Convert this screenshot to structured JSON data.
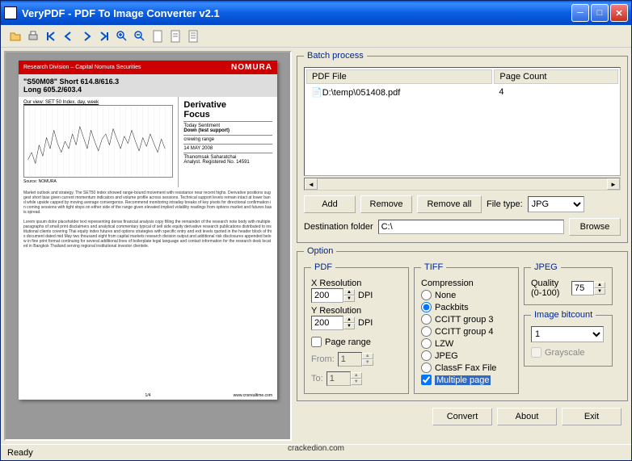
{
  "window": {
    "title": "VeryPDF - PDF To Image Converter v2.1"
  },
  "toolbar_icons": [
    "open-icon",
    "print-icon",
    "first-icon",
    "prev-icon",
    "next-icon",
    "last-icon",
    "zoomin-icon",
    "zoomout-icon",
    "page1-icon",
    "page2-icon",
    "page3-icon"
  ],
  "preview": {
    "header_left": "Research Division – Capital Nomura Securities",
    "header_brand": "NOMURA",
    "title_line1": "\"S50M08\" Short 614.8/616.3",
    "title_line2": "Long 605.2/603.4",
    "ourview": "Our view: SET 50 Index, day, week",
    "side_h1": "Derivative",
    "side_h2": "Focus",
    "side_sent_label": "Today Sentiment",
    "side_sent_val": "Down (test support)",
    "side_strategy": "crewing range",
    "side_date": "14 MAY 2008",
    "side_analyst1": "Thanomsak Saharatchai",
    "side_analyst2": "Analyst. Registered No. 14591",
    "footer_url": "www.cnsrealtime.com",
    "page_num": "1/4"
  },
  "batch": {
    "legend": "Batch process",
    "col_file": "PDF File",
    "col_count": "Page Count",
    "row_file": "D:\\temp\\051408.pdf",
    "row_count": "4",
    "add": "Add",
    "remove": "Remove",
    "removeall": "Remove all",
    "filetype_label": "File type:",
    "filetype_value": "JPG",
    "dest_label": "Destination folder",
    "dest_value": "C:\\",
    "browse": "Browse"
  },
  "option": {
    "legend": "Option",
    "pdf": {
      "legend": "PDF",
      "xres": "X Resolution",
      "yres": "Y Resolution",
      "xval": "200",
      "yval": "200",
      "dpi": "DPI",
      "pagerange": "Page range",
      "from": "From:",
      "to": "To:",
      "fromval": "1",
      "toval": "1"
    },
    "tiff": {
      "legend": "TIFF",
      "comp": "Compression",
      "none": "None",
      "packbits": "Packbits",
      "ccitt3": "CCITT group 3",
      "ccitt4": "CCITT group 4",
      "lzw": "LZW",
      "jpeg": "JPEG",
      "classf": "ClassF Fax File",
      "multi": "Multiple page"
    },
    "jpeg": {
      "legend": "JPEG",
      "quality": "Quality (0-100)",
      "qval": "75"
    },
    "bitcount": {
      "legend": "Image bitcount",
      "val": "1",
      "gray": "Grayscale"
    }
  },
  "footer": {
    "convert": "Convert",
    "about": "About",
    "exit": "Exit"
  },
  "status": "Ready",
  "watermark": "crackedion.com"
}
